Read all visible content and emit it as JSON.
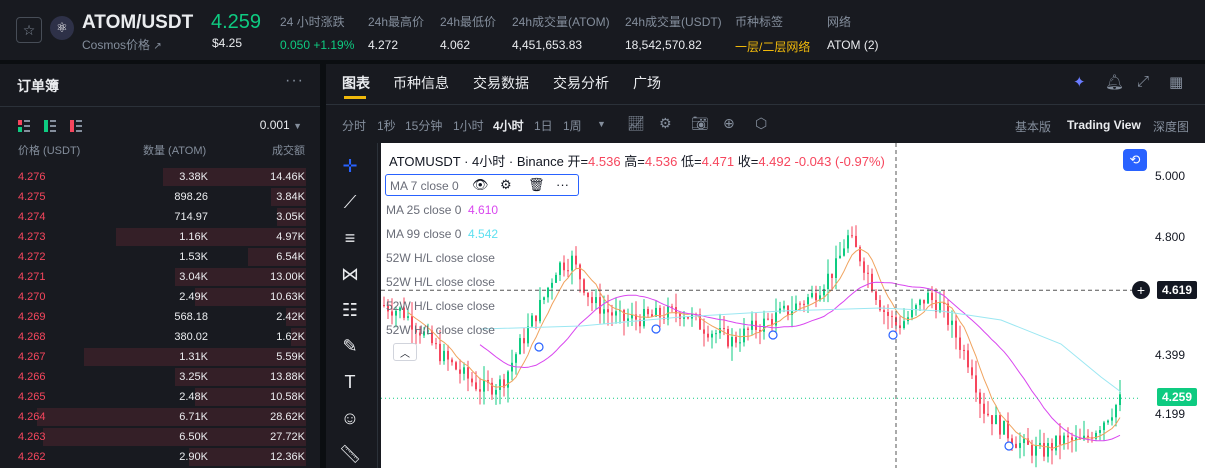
{
  "ticker": {
    "star_icon": "star-icon",
    "logo_icon": "atom-logo-icon",
    "pair": "ATOM/USDT",
    "pair_sub": "Cosmos价格",
    "pair_sub_icon": "external-link-icon",
    "last_price": "4.259",
    "last_usd": "$4.25",
    "stats": [
      {
        "label": "24 小时涨跌",
        "value": "0.050 +1.19%",
        "style": "green"
      },
      {
        "label": "24h最高价",
        "value": "4.272",
        "style": ""
      },
      {
        "label": "24h最低价",
        "value": "4.062",
        "style": ""
      },
      {
        "label": "24h成交量(ATOM)",
        "value": "4,451,653.83",
        "style": ""
      },
      {
        "label": "24h成交量(USDT)",
        "value": "18,542,570.82",
        "style": ""
      },
      {
        "label": "币种标签",
        "value": "一层/二层网络",
        "style": "gold"
      },
      {
        "label": "网络",
        "value": "ATOM (2)",
        "style": ""
      }
    ]
  },
  "orderbook": {
    "title": "订单簿",
    "more_icon": "more-dots-icon",
    "step": "0.001",
    "columns": [
      "价格 (USDT)",
      "数量 (ATOM)",
      "成交额"
    ],
    "asks": [
      {
        "price": "4.276",
        "qty": "3.38K",
        "total": "14.46K",
        "depth": 0.49
      },
      {
        "price": "4.275",
        "qty": "898.26",
        "total": "3.84K",
        "depth": 0.12
      },
      {
        "price": "4.274",
        "qty": "714.97",
        "total": "3.05K",
        "depth": 0.1
      },
      {
        "price": "4.273",
        "qty": "1.16K",
        "total": "4.97K",
        "depth": 0.65
      },
      {
        "price": "4.272",
        "qty": "1.53K",
        "total": "6.54K",
        "depth": 0.2
      },
      {
        "price": "4.271",
        "qty": "3.04K",
        "total": "13.00K",
        "depth": 0.45
      },
      {
        "price": "4.270",
        "qty": "2.49K",
        "total": "10.63K",
        "depth": 0.38
      },
      {
        "price": "4.269",
        "qty": "568.18",
        "total": "2.42K",
        "depth": 0.07
      },
      {
        "price": "4.268",
        "qty": "380.02",
        "total": "1.62K",
        "depth": 0.05
      },
      {
        "price": "4.267",
        "qty": "1.31K",
        "total": "5.59K",
        "depth": 0.76
      },
      {
        "price": "4.266",
        "qty": "3.25K",
        "total": "13.88K",
        "depth": 0.45
      },
      {
        "price": "4.265",
        "qty": "2.48K",
        "total": "10.58K",
        "depth": 0.38
      },
      {
        "price": "4.264",
        "qty": "6.71K",
        "total": "28.62K",
        "depth": 0.92
      },
      {
        "price": "4.263",
        "qty": "6.50K",
        "total": "27.72K",
        "depth": 0.9
      },
      {
        "price": "4.262",
        "qty": "2.90K",
        "total": "12.36K",
        "depth": 0.4
      }
    ]
  },
  "chart": {
    "tabs": [
      "图表",
      "币种信息",
      "交易数据",
      "交易分析",
      "广场"
    ],
    "intervals": [
      "分时",
      "1秒",
      "15分钟",
      "1小时",
      "4小时",
      "1日",
      "1周"
    ],
    "active_interval": "4小时",
    "views": [
      "基本版",
      "Trading View",
      "深度图"
    ],
    "active_view": "Trading View",
    "ohlc": {
      "symbol": "ATOMUSDT · 4小时 · Binance",
      "open_label": "开=",
      "open": "4.536",
      "high_label": "高=",
      "high": "4.536",
      "low_label": "低=",
      "low": "4.471",
      "close_label": "收=",
      "close": "4.492",
      "change": "-0.043 (-0.97%)"
    },
    "indicators": [
      {
        "label": "MA 7 close 0",
        "value": "",
        "color": "#f0a35e"
      },
      {
        "label": "MA 25 close 0",
        "value": "4.610",
        "color": "#d946ef"
      },
      {
        "label": "MA 99 close 0",
        "value": "4.542",
        "color": "#5ee0f0"
      },
      {
        "label": "52W H/L close close",
        "value": "",
        "color": ""
      },
      {
        "label": "52W H/L close close",
        "value": "",
        "color": ""
      },
      {
        "label": "52W H/L close close",
        "value": "",
        "color": ""
      },
      {
        "label": "52W H/L close close",
        "value": "",
        "color": ""
      }
    ],
    "price_scale": [
      "5.000",
      "4.800",
      "4.399",
      "4.199"
    ],
    "crosshair_price": "4.619",
    "current_price": "4.259",
    "colors": {
      "up": "#0ecb81",
      "down": "#f6465d",
      "accent": "#f0b90b",
      "blue": "#2962ff"
    }
  }
}
